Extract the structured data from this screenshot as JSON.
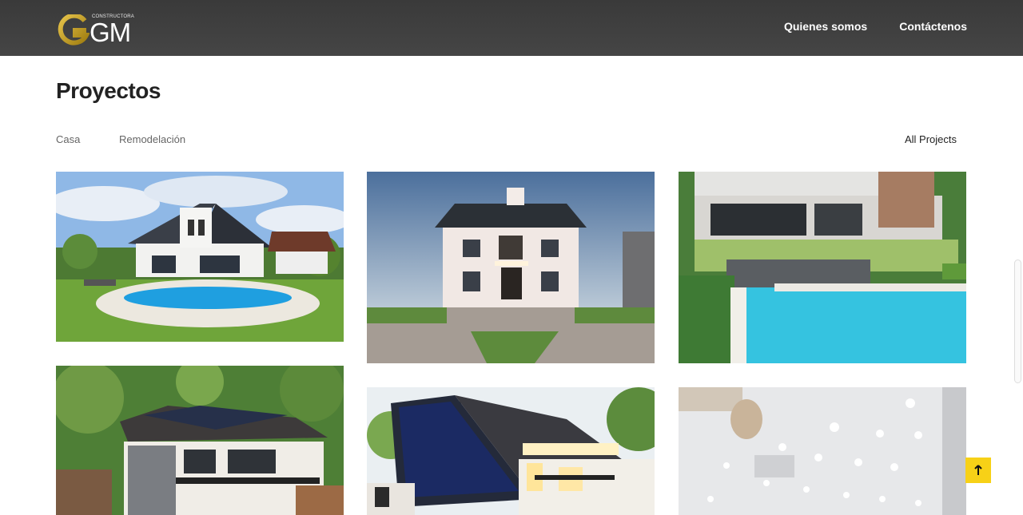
{
  "header": {
    "logo": {
      "tagline": "CONSTRUCTORA",
      "name": "GM"
    },
    "nav": [
      {
        "label": "Quienes somos"
      },
      {
        "label": "Contáctenos"
      }
    ]
  },
  "page": {
    "title": "Proyectos"
  },
  "filters": [
    {
      "label": "Casa"
    },
    {
      "label": "Remodelación"
    },
    {
      "label": "All Projects"
    }
  ],
  "projects": [
    {
      "icon": "house-pool-solar-image"
    },
    {
      "icon": "mansion-dusk-image"
    },
    {
      "icon": "modern-house-pool-image"
    },
    {
      "icon": "two-story-solar-house-image"
    },
    {
      "icon": "solar-roof-house-image"
    },
    {
      "icon": "ceiling-lights-interior-image"
    }
  ],
  "colors": {
    "accent": "#f7d117",
    "header": "#404040",
    "logo_gold": "#c9a227"
  },
  "back_to_top": {
    "icon": "arrow-up-icon"
  }
}
